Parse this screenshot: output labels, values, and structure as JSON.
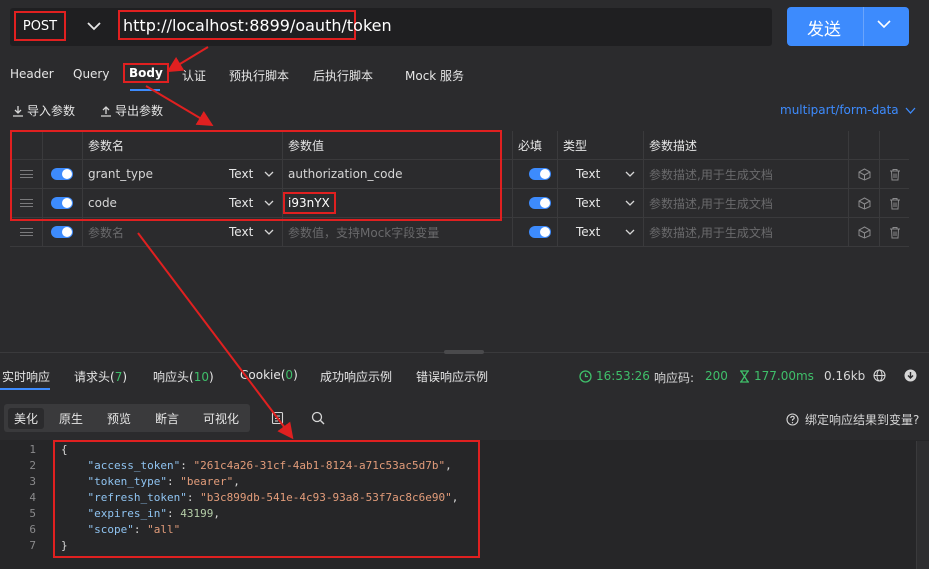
{
  "request": {
    "method": "POST",
    "url": "http://localhost:8899/oauth/token",
    "send_label": "发送"
  },
  "tabs": [
    "Header",
    "Query",
    "Body",
    "认证",
    "预执行脚本",
    "后执行脚本",
    "Mock 服务"
  ],
  "active_tab": "Body",
  "toolbar": {
    "import_label": "导入参数",
    "export_label": "导出参数",
    "form_type": "multipart/form-data"
  },
  "params_table": {
    "headers": {
      "name": "参数名",
      "value": "参数值",
      "required": "必填",
      "type": "类型",
      "desc": "参数描述"
    },
    "rows": [
      {
        "name": "grant_type",
        "name_type": "Text",
        "value": "authorization_code",
        "type": "Text",
        "desc_placeholder": "参数描述,用于生成文档"
      },
      {
        "name": "code",
        "name_type": "Text",
        "value": "i93nYX",
        "type": "Text",
        "desc_placeholder": "参数描述,用于生成文档"
      }
    ],
    "empty_row": {
      "name_placeholder": "参数名",
      "name_type": "Text",
      "value_placeholder": "参数值，支持Mock字段变量",
      "type": "Text",
      "desc_placeholder": "参数描述,用于生成文档"
    }
  },
  "response": {
    "tabs": {
      "realtime": "实时响应",
      "req_headers": "请求头",
      "req_headers_count": "7",
      "resp_headers": "响应头",
      "resp_headers_count": "10",
      "cookie": "Cookie",
      "cookie_count": "0",
      "success_example": "成功响应示例",
      "error_example": "错误响应示例"
    },
    "time": "16:53:26",
    "status_label": "响应码:",
    "status_code": "200",
    "duration": "177.00ms",
    "size": "0.16kb",
    "view_modes": [
      "美化",
      "原生",
      "预览",
      "断言",
      "可视化"
    ],
    "bind_label": "绑定响应结果到变量?",
    "code_lines": [
      {
        "n": "1",
        "text": "{"
      },
      {
        "n": "2",
        "key": "\"access_token\"",
        "val": "\"261c4a26-31cf-4ab1-8124-a71c53ac5d7b\"",
        "kind": "s"
      },
      {
        "n": "3",
        "key": "\"token_type\"",
        "val": "\"bearer\"",
        "kind": "s"
      },
      {
        "n": "4",
        "key": "\"refresh_token\"",
        "val": "\"b3c899db-541e-4c93-93a8-53f7ac8c6e90\"",
        "kind": "s"
      },
      {
        "n": "5",
        "key": "\"expires_in\"",
        "val": "43199",
        "kind": "n"
      },
      {
        "n": "6",
        "key": "\"scope\"",
        "val": "\"all\"",
        "kind": "s",
        "last": true
      },
      {
        "n": "7",
        "text": "}"
      }
    ]
  },
  "colors": {
    "accent": "#3d8bfd",
    "annotation": "#e02020",
    "success": "#3fbf6a"
  }
}
